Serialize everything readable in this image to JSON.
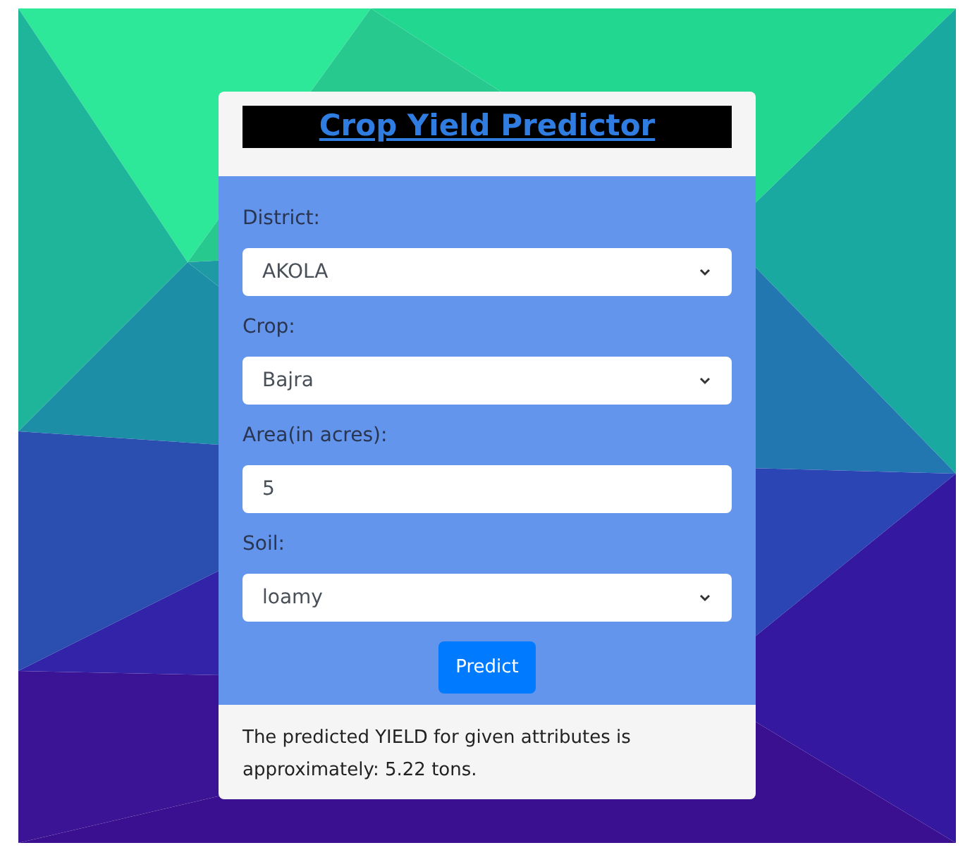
{
  "title": "Crop Yield Predictor",
  "fields": [
    {
      "label": "District:",
      "kind": "select",
      "value": "AKOLA"
    },
    {
      "label": "Crop:",
      "kind": "select",
      "value": "Bajra"
    },
    {
      "label": "Area(in acres):",
      "kind": "input",
      "value": "5"
    },
    {
      "label": "Soil:",
      "kind": "select",
      "value": "loamy"
    }
  ],
  "button": "Predict",
  "result": "The predicted YIELD for given attributes is approximately: 5.22 tons."
}
